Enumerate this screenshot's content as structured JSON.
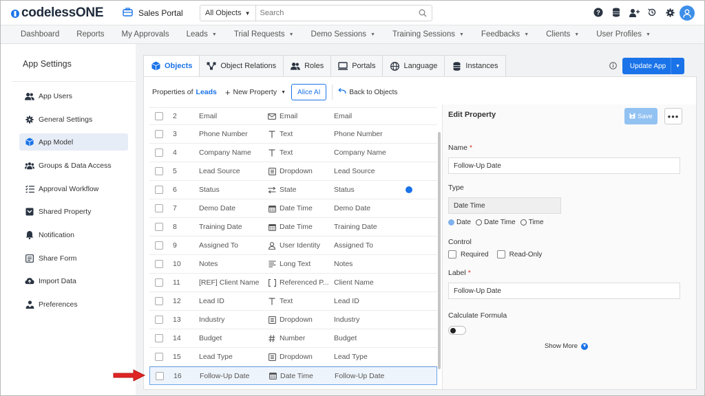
{
  "app": {
    "logo": "codelessONE",
    "portal": "Sales Portal"
  },
  "search": {
    "scope": "All Objects",
    "placeholder": "Search"
  },
  "nav": [
    "Dashboard",
    "Reports",
    "My Approvals",
    "Leads",
    "Trial Requests",
    "Demo Sessions",
    "Training Sessions",
    "Feedbacks",
    "Clients",
    "User Profiles"
  ],
  "nav_dropdown": [
    false,
    false,
    false,
    true,
    true,
    true,
    true,
    true,
    true,
    true
  ],
  "sidebar": {
    "title": "App Settings",
    "items": [
      {
        "label": "App Users",
        "icon": "users-icon"
      },
      {
        "label": "General Settings",
        "icon": "gear-icon"
      },
      {
        "label": "App Model",
        "icon": "cube-icon",
        "active": true
      },
      {
        "label": "Groups & Data Access",
        "icon": "group-icon"
      },
      {
        "label": "Approval Workflow",
        "icon": "checklist-icon"
      },
      {
        "label": "Shared Property",
        "icon": "shared-property-icon"
      },
      {
        "label": "Notification",
        "icon": "bell-icon"
      },
      {
        "label": "Share Form",
        "icon": "form-icon"
      },
      {
        "label": "Import Data",
        "icon": "cloud-upload-icon"
      },
      {
        "label": "Preferences",
        "icon": "preferences-icon"
      }
    ]
  },
  "tabs": [
    {
      "label": "Objects",
      "active": true
    },
    {
      "label": "Object Relations"
    },
    {
      "label": "Roles"
    },
    {
      "label": "Portals"
    },
    {
      "label": "Language"
    },
    {
      "label": "Instances"
    }
  ],
  "update_button": "Update App",
  "toolbar": {
    "properties_of": "Properties of",
    "object": "Leads",
    "new_property": "New Property",
    "alice": "Alice AI",
    "back": "Back to Objects"
  },
  "rows": [
    {
      "num": "2",
      "name": "Email",
      "type": "Email",
      "icon": "envelope-icon",
      "label": "Email"
    },
    {
      "num": "3",
      "name": "Phone Number",
      "type": "Text",
      "icon": "text-icon",
      "label": "Phone Number"
    },
    {
      "num": "4",
      "name": "Company Name",
      "type": "Text",
      "icon": "text-icon",
      "label": "Company Name"
    },
    {
      "num": "5",
      "name": "Lead Source",
      "type": "Dropdown",
      "icon": "dropdown-icon",
      "label": "Lead Source"
    },
    {
      "num": "6",
      "name": "Status",
      "type": "State",
      "icon": "state-icon",
      "label": "Status",
      "dot": true
    },
    {
      "num": "7",
      "name": "Demo Date",
      "type": "Date Time",
      "icon": "calendar-icon",
      "label": "Demo Date"
    },
    {
      "num": "8",
      "name": "Training Date",
      "type": "Date Time",
      "icon": "calendar-icon",
      "label": "Training Date"
    },
    {
      "num": "9",
      "name": "Assigned To",
      "type": "User Identity",
      "icon": "user-icon",
      "label": "Assigned To"
    },
    {
      "num": "10",
      "name": "Notes",
      "type": "Long Text",
      "icon": "long-text-icon",
      "label": "Notes"
    },
    {
      "num": "11",
      "name": "[REF] Client Name",
      "type": "Referenced P...",
      "icon": "reference-icon",
      "label": "Client Name"
    },
    {
      "num": "12",
      "name": "Lead ID",
      "type": "Text",
      "icon": "text-icon",
      "label": "Lead ID"
    },
    {
      "num": "13",
      "name": "Industry",
      "type": "Dropdown",
      "icon": "dropdown-icon",
      "label": "Industry"
    },
    {
      "num": "14",
      "name": "Budget",
      "type": "Number",
      "icon": "number-icon",
      "label": "Budget"
    },
    {
      "num": "15",
      "name": "Lead Type",
      "type": "Dropdown",
      "icon": "dropdown-icon",
      "label": "Lead Type"
    },
    {
      "num": "16",
      "name": "Follow-Up Date",
      "type": "Date Time",
      "icon": "calendar-icon",
      "label": "Follow-Up Date",
      "selected": true
    }
  ],
  "edit": {
    "title": "Edit Property",
    "save": "Save",
    "more": "•••",
    "name_label": "Name",
    "name_value": "Follow-Up Date",
    "type_label": "Type",
    "type_value": "Date Time",
    "type_options": [
      "Date",
      "Date Time",
      "Time"
    ],
    "type_selected": "Date",
    "control_label": "Control",
    "controls": [
      "Required",
      "Read-Only"
    ],
    "label_label": "Label",
    "label_value": "Follow-Up Date",
    "formula_label": "Calculate Formula",
    "formula_enabled": false,
    "show_more": "Show More"
  },
  "colors": {
    "accent": "#1a73e8",
    "annotation_arrow": "#e02424"
  }
}
